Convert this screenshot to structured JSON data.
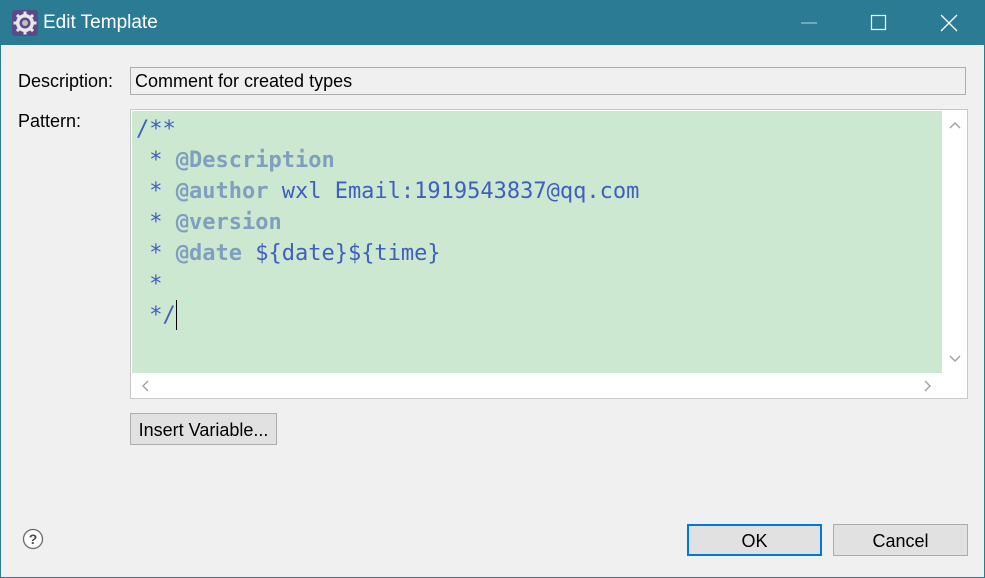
{
  "window": {
    "title": "Edit Template",
    "icon": "eclipse-gear-icon",
    "controls": [
      "minimize-icon",
      "maximize-icon",
      "close-icon"
    ]
  },
  "form": {
    "description_label": "Description:",
    "description_value": "Comment for created types",
    "pattern_label": "Pattern:"
  },
  "pattern": {
    "line1": "/**",
    "line2_prefix": " * ",
    "line2_tag": "@Description",
    "line3_prefix": " * ",
    "line3_tag": "@author",
    "line3_text": " wxl Email:1919543837@qq.com",
    "line4_prefix": " * ",
    "line4_tag": "@version",
    "line5_prefix": " * ",
    "line5_tag": "@date",
    "line5_text": " ${date}${time}",
    "line6": " *",
    "line7": " */"
  },
  "buttons": {
    "insert_variable": "Insert Variable...",
    "ok": "OK",
    "cancel": "Cancel",
    "help_icon": "help-icon"
  },
  "colors": {
    "titlebar": "#2c7b94",
    "editor_background": "#cde8d1",
    "javadoc_text": "#3f5fbf",
    "javadoc_tag": "#7f9fbf",
    "default_button_border": "#0078d7"
  }
}
